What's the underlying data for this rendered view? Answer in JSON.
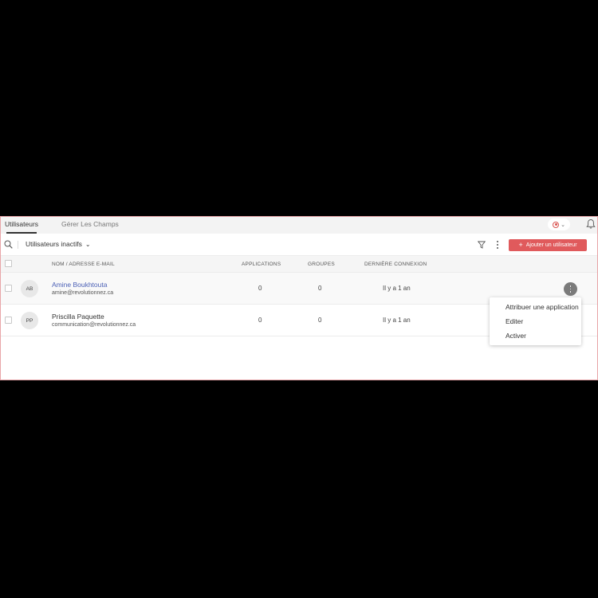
{
  "tabs": [
    {
      "label": "Utilisateurs",
      "active": true
    },
    {
      "label": "Gérer Les Champs",
      "active": false
    }
  ],
  "toolbar": {
    "filter_label": "Utilisateurs inactifs",
    "add_button_label": "Ajouter un utilisateur",
    "add_button_icon": "plus-icon"
  },
  "table": {
    "headers": {
      "name": "NOM / ADRESSE E-MAIL",
      "applications": "APPLICATIONS",
      "groups": "GROUPES",
      "last_login": "DERNIÈRE CONNEXION"
    },
    "rows": [
      {
        "initials": "AB",
        "name": "Amine Boukhtouta",
        "email": "amine@revolutionnez.ca",
        "applications": "0",
        "groups": "0",
        "last_login": "Il y a 1 an"
      },
      {
        "initials": "PP",
        "name": "Priscilla Paquette",
        "email": "communication@revolutionnez.ca",
        "applications": "0",
        "groups": "0",
        "last_login": "Il y a 1 an"
      }
    ]
  },
  "context_menu": {
    "items": [
      "Attribuer une application",
      "Editer",
      "Activer"
    ]
  },
  "colors": {
    "accent": "#e05a5c",
    "link": "#4a5fb5",
    "frame_border": "#e8a5a8"
  }
}
